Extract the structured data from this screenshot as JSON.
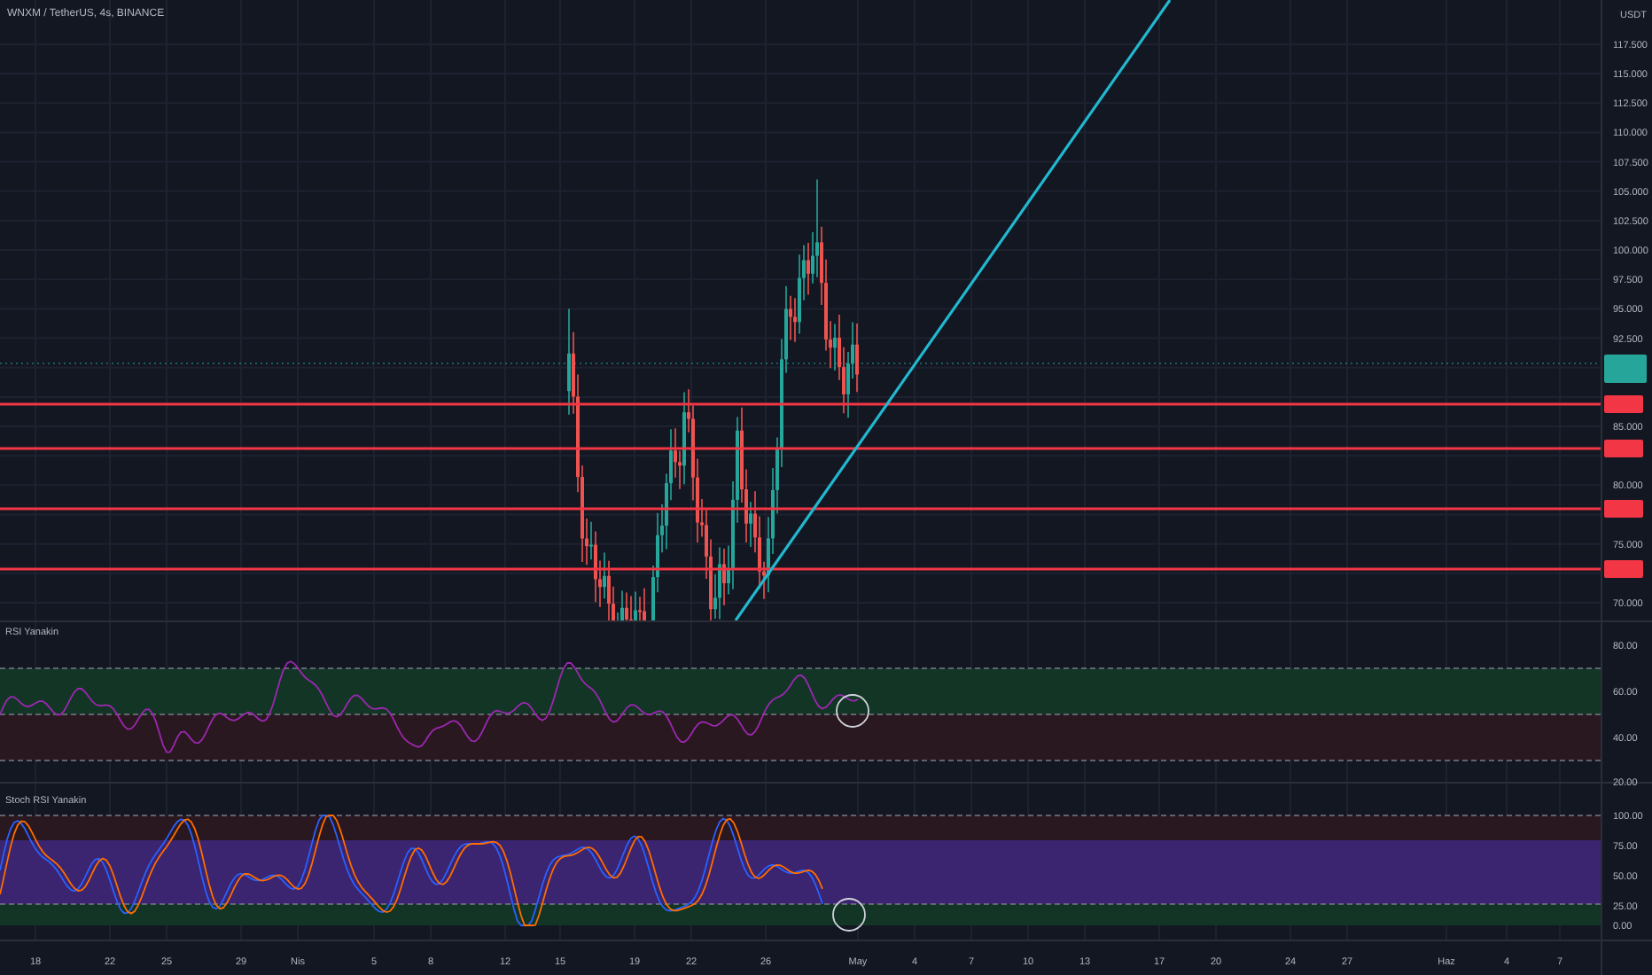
{
  "symbol_title": "WNXM / TetherUS, 4s, BINANCE",
  "currency": "USDT",
  "price_axis": [
    "117.500",
    "115.000",
    "112.500",
    "110.000",
    "107.500",
    "105.000",
    "102.500",
    "100.000",
    "97.500",
    "95.000",
    "92.500",
    "85.000",
    "80.000",
    "75.000",
    "70.000"
  ],
  "rsi_pane": {
    "title": "RSI Yanakin",
    "ticks": [
      "80.00",
      "60.00",
      "40.00",
      "20.00"
    ]
  },
  "stoch_pane": {
    "title": "Stoch RSI Yanakin",
    "ticks": [
      "100.00",
      "75.00",
      "50.00",
      "25.00",
      "0.00"
    ]
  },
  "time_axis": [
    "18",
    "22",
    "25",
    "29",
    "Nis",
    "5",
    "8",
    "12",
    "15",
    "19",
    "22",
    "26",
    "May",
    "4",
    "7",
    "10",
    "13",
    "17",
    "20",
    "24",
    "27",
    "Haz",
    "4",
    "7"
  ]
}
